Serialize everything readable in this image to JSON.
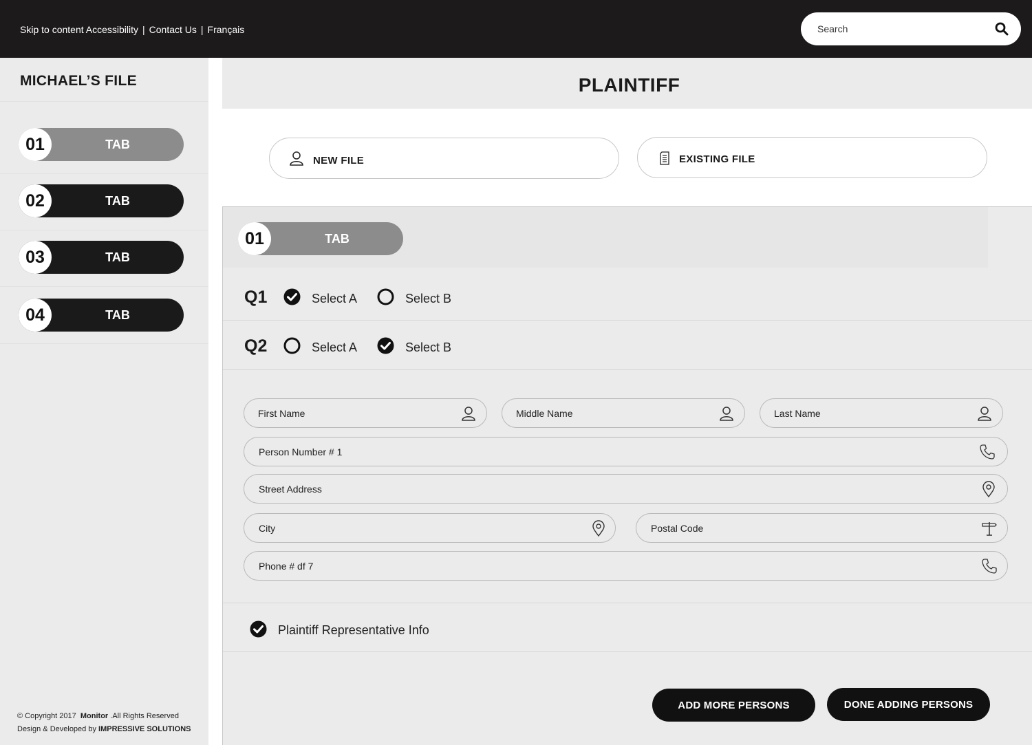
{
  "header": {
    "links": [
      "Skip to content",
      "Accessibility",
      "Contact Us",
      "Français"
    ],
    "search_placeholder": "Search"
  },
  "sidebar": {
    "title": "MICHAEL’S FILE",
    "tabs": [
      {
        "num": "01",
        "label": "TAB",
        "active": true
      },
      {
        "num": "02",
        "label": "TAB",
        "active": false
      },
      {
        "num": "03",
        "label": "TAB",
        "active": false
      },
      {
        "num": "04",
        "label": "TAB",
        "active": false
      }
    ],
    "footer": {
      "copyright": "© Copyright 2017",
      "brand": "Monitor",
      "rights": ".All Rights Reserved",
      "designed": "Design & Developed by",
      "company": "IMPRESSIVE SOLUTIONS"
    }
  },
  "main": {
    "title": "PLAINTIFF",
    "new_file": "NEW FILE",
    "existing_file": "EXISTING FILE",
    "section_tab": {
      "num": "01",
      "label": "TAB"
    },
    "questions": [
      {
        "label": "Q1",
        "option_a": "Select A",
        "option_b": "Select B",
        "selected": "A"
      },
      {
        "label": "Q2",
        "option_a": "Select A",
        "option_b": "Select B",
        "selected": "B"
      }
    ],
    "form": {
      "first_name": "First Name",
      "middle_name": "Middle Name",
      "last_name": "Last Name",
      "person_number": "Person Number # 1",
      "street": "Street Address",
      "city": "City",
      "postal": "Postal Code",
      "phone": "Phone # df 7"
    },
    "rep_info": {
      "label": "Plaintiff Representative Info",
      "checked": true
    },
    "add_more": "ADD MORE PERSONS",
    "done_adding": "DONE ADDING PERSONS"
  },
  "colors": {
    "dark": "#1c1a1b",
    "active_tab": "#8c8c8c",
    "panel": "#ebebeb"
  }
}
